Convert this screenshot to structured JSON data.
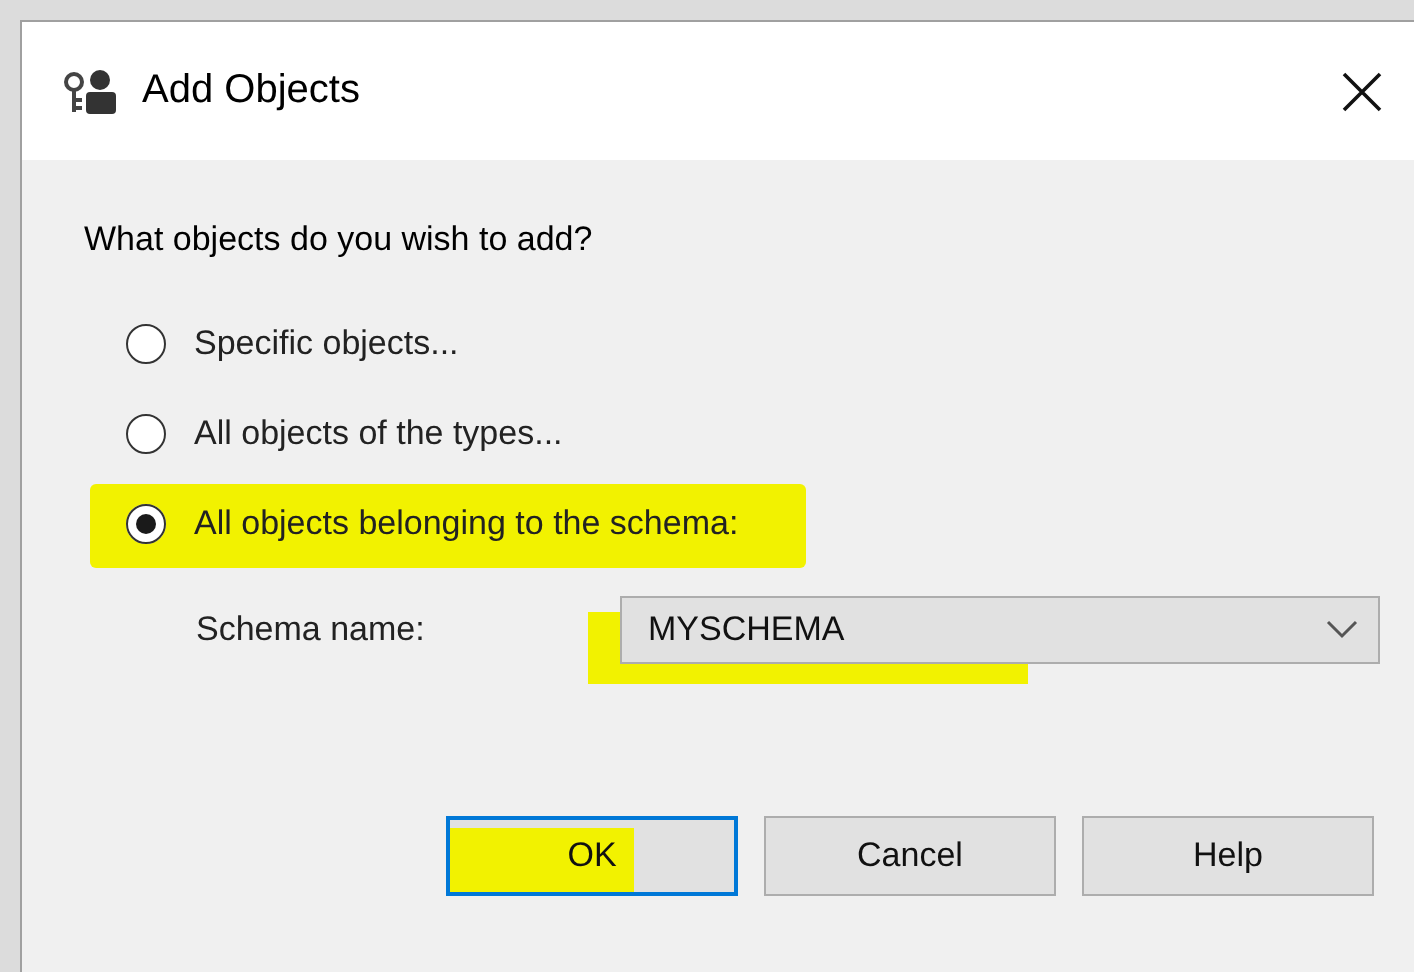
{
  "window": {
    "title": "Add Objects"
  },
  "question": "What objects do you wish to add?",
  "options": [
    {
      "label": "Specific objects...",
      "selected": false,
      "highlighted": false
    },
    {
      "label": "All objects of the types...",
      "selected": false,
      "highlighted": false
    },
    {
      "label": "All objects belonging to the schema:",
      "selected": true,
      "highlighted": true
    }
  ],
  "schema": {
    "label": "Schema name:",
    "value": "MYSCHEMA",
    "highlighted": true
  },
  "buttons": [
    {
      "label": "OK",
      "default": true,
      "highlighted": true
    },
    {
      "label": "Cancel",
      "default": false,
      "highlighted": false
    },
    {
      "label": "Help",
      "default": false,
      "highlighted": false
    }
  ]
}
